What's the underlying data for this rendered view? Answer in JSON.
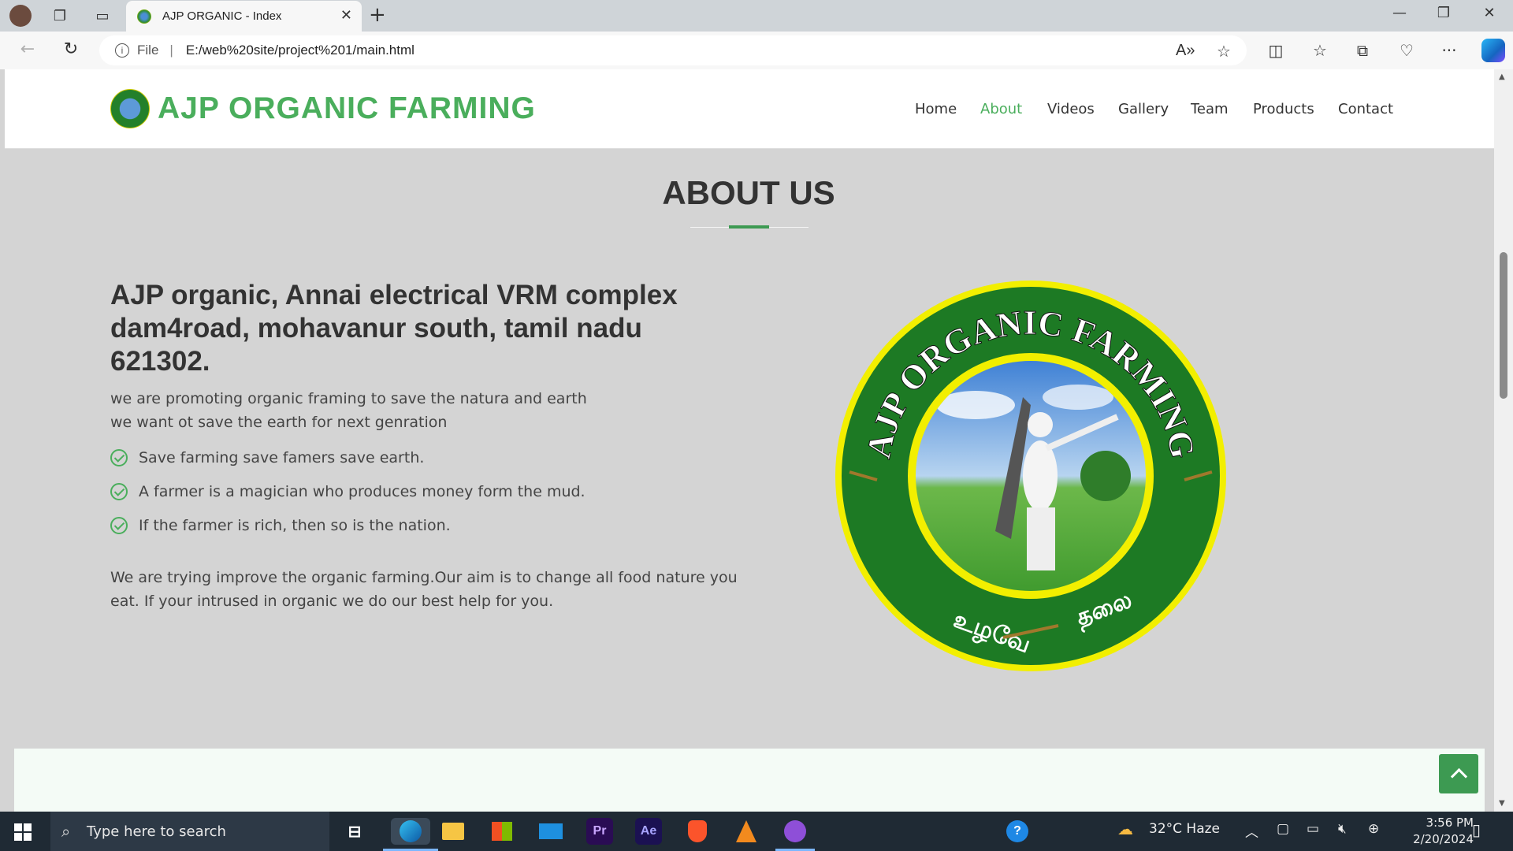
{
  "browser": {
    "tab_title": "AJP ORGANIC - Index",
    "url_prefix": "File",
    "url": "E:/web%20site/project%201/main.html"
  },
  "site": {
    "brand": "AJP ORGANIC FARMING",
    "nav": [
      "Home",
      "About",
      "Videos",
      "Gallery",
      "Team",
      "Products",
      "Contact"
    ],
    "active_nav": "About"
  },
  "about": {
    "title": "ABOUT US",
    "heading": "AJP organic, Annai electrical VRM complex dam4road, mohavanur south, tamil nadu 621302.",
    "intro_line1": "we are promoting organic framing to save the natura and earth",
    "intro_line2": "we want ot save the earth for next genration",
    "features": [
      "Save farming save famers save earth.",
      "A farmer is a magician who produces money form the mud.",
      "If the farmer is rich, then so is the nation."
    ],
    "closing": "We are trying improve the organic farming.Our aim is to change all food nature you eat. If your intrused in organic we do our best help for you.",
    "emblem_text_top": "AJP ORGANIC FARMING",
    "emblem_text_left": "உழவே",
    "emblem_text_right": "தலை"
  },
  "taskbar": {
    "search_placeholder": "Type here to search",
    "weather": "32°C  Haze",
    "time": "3:56 PM",
    "date": "2/20/2024"
  },
  "colors": {
    "brand_green": "#4aae5c",
    "accent_green": "#3d9a52",
    "page_bg": "#d4d4d4"
  }
}
